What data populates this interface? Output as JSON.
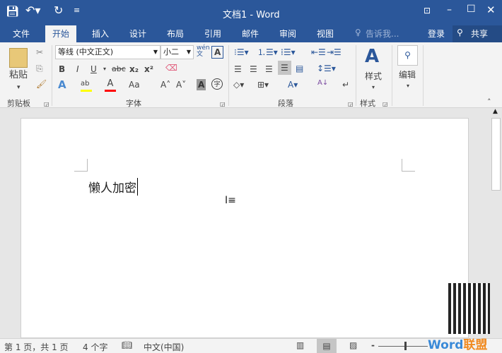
{
  "title": "文档1 - Word",
  "quick_access": [
    "save-icon",
    "undo-icon",
    "redo-icon",
    "customize-icon"
  ],
  "tabs": [
    "文件",
    "开始",
    "插入",
    "设计",
    "布局",
    "引用",
    "邮件",
    "审阅",
    "视图"
  ],
  "active_tab": "开始",
  "tell_me": "告诉我...",
  "login": "登录",
  "share": "共享",
  "clipboard": {
    "paste": "粘贴",
    "group": "剪贴板"
  },
  "font": {
    "name": "等线 (中文正文)",
    "size": "小二",
    "group": "字体",
    "bold": "B",
    "italic": "I",
    "underline": "U",
    "strike": "abc",
    "sub": "x₂",
    "sup": "x²",
    "aa": "Aa",
    "phonetic": "wén 文",
    "highlight_color": "#ffff00",
    "font_color": "#ff0000"
  },
  "paragraph": {
    "group": "段落"
  },
  "styles": {
    "label": "样式",
    "group": "样式"
  },
  "editing": {
    "label": "编辑"
  },
  "document": {
    "text": "懒人加密"
  },
  "status": {
    "page": "第 1 页，共 1 页",
    "words": "4 个字",
    "language": "中文(中国)",
    "zoom_minus": "-"
  },
  "watermark": "Word联盟 www.wordlm.com",
  "colors": {
    "brand": "#2b579a",
    "ribbon": "#f3f3f3"
  }
}
